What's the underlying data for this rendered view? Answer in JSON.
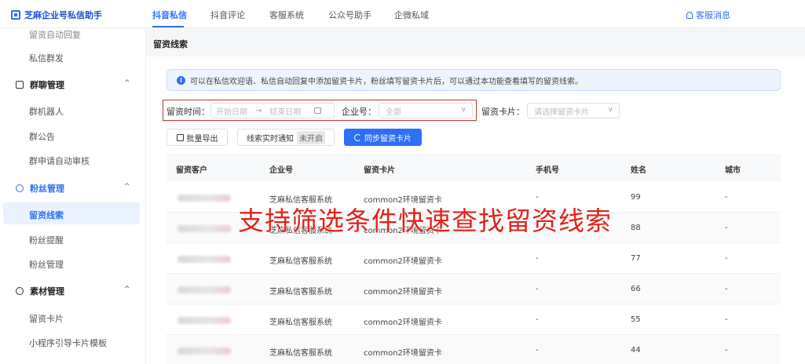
{
  "app": {
    "title": "芝麻企业号私信助手"
  },
  "nav": {
    "tabs": [
      {
        "label": "抖音私信",
        "active": true
      },
      {
        "label": "抖音评论"
      },
      {
        "label": "客服系统"
      },
      {
        "label": "公众号助手"
      },
      {
        "label": "企微私域"
      }
    ],
    "service_label": "客服消息"
  },
  "sidebar": {
    "items": [
      {
        "label": "留资自动回复"
      },
      {
        "label": "私信群发"
      },
      {
        "label": "群聊管理",
        "group": true
      },
      {
        "label": "群机器人"
      },
      {
        "label": "群公告"
      },
      {
        "label": "群申请自动审核"
      },
      {
        "label": "粉丝管理",
        "group": true
      },
      {
        "label": "留资线索",
        "active": true
      },
      {
        "label": "粉丝提醒"
      },
      {
        "label": "粉丝管理"
      },
      {
        "label": "素材管理",
        "group": true
      },
      {
        "label": "留资卡片"
      },
      {
        "label": "小程序引导卡片模板"
      }
    ]
  },
  "page": {
    "title": "留资线索",
    "info": "可以在私信欢迎语、私信自动回复中添加留资卡片，粉丝填写留资卡片后，可以通过本功能查看填写的留资线索。"
  },
  "filters": {
    "time_label": "留资时间：",
    "start_placeholder": "开始日期",
    "range_sep": "→",
    "end_placeholder": "结束日期",
    "enterprise_label": "企业号：",
    "enterprise_value": "全部",
    "card_label": "留资卡片：",
    "card_placeholder": "请选择留资卡片"
  },
  "actions": {
    "export_label": "批量导出",
    "notify_label": "线索实时通知",
    "notify_status": "未开启",
    "sync_label": "同步留资卡片"
  },
  "table": {
    "columns": [
      "留资客户",
      "企业号",
      "留资卡片",
      "手机号",
      "姓名",
      "城市"
    ],
    "rows": [
      {
        "enterprise": "芝麻私信客服系统",
        "card": "common2环境留资卡",
        "phone": "-",
        "name": "99",
        "city": "-"
      },
      {
        "enterprise": "芝麻私信客服系统",
        "card": "common2环境留资卡",
        "phone": "-",
        "name": "88",
        "city": "-"
      },
      {
        "enterprise": "芝麻私信客服系统",
        "card": "common2环境留资卡",
        "phone": "-",
        "name": "77",
        "city": "-"
      },
      {
        "enterprise": "芝麻私信客服系统",
        "card": "common2环境留资卡",
        "phone": "-",
        "name": "66",
        "city": "-"
      },
      {
        "enterprise": "芝麻私信客服系统",
        "card": "common2环境留资卡",
        "phone": "-",
        "name": "55",
        "city": "-"
      },
      {
        "enterprise": "芝麻私信客服系统",
        "card": "common2环境留资卡",
        "phone": "-",
        "name": "44",
        "city": "-"
      }
    ]
  },
  "overlay_text": "支持筛选条件快速查找留资线索",
  "colors": {
    "accent": "#2d6ff6",
    "highlight": "#c0392b",
    "overlay": "#e2231a"
  }
}
